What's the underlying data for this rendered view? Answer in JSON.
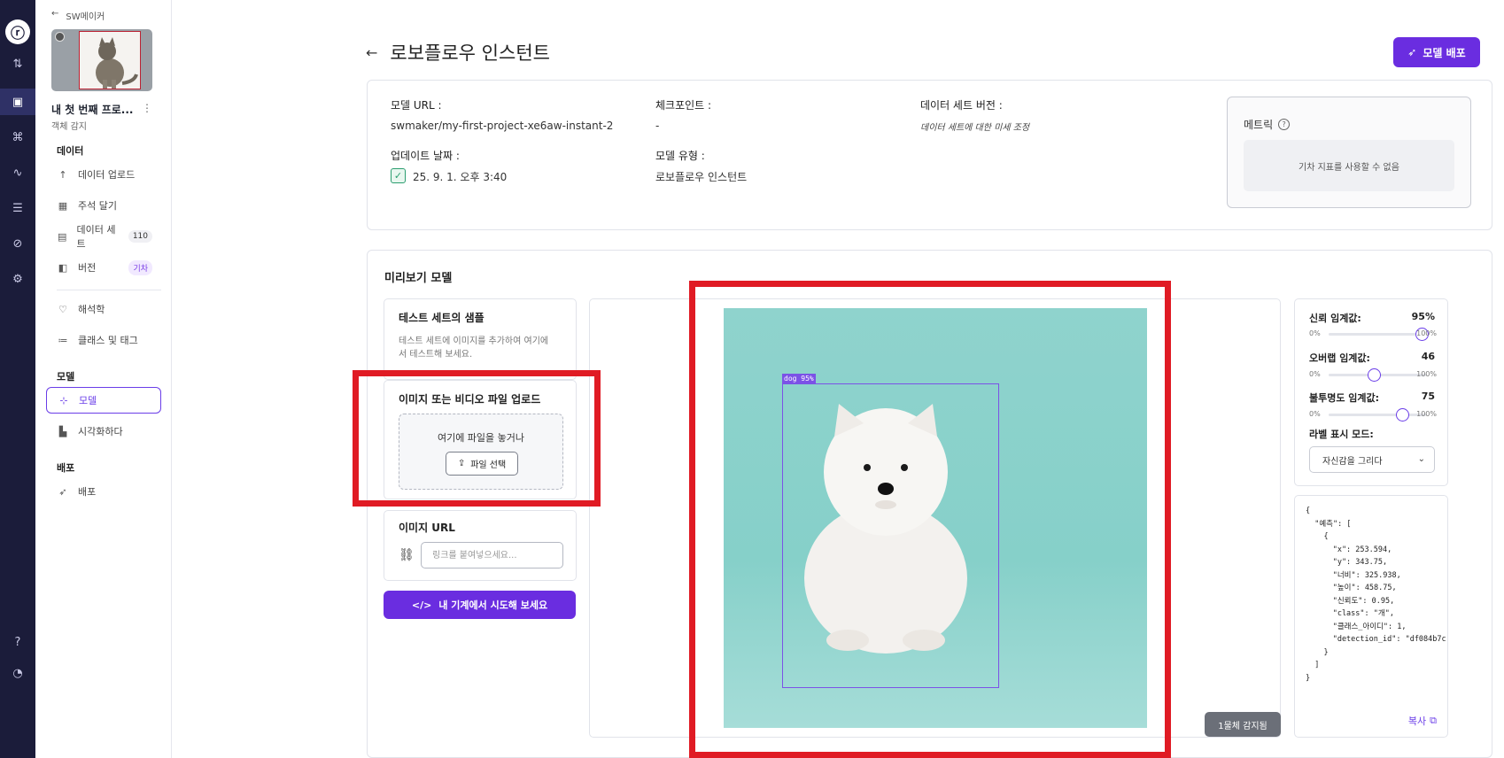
{
  "rail": {
    "icons": [
      "logo-icon",
      "sort-icon",
      "project-icon",
      "hierarchy-icon",
      "analytics-icon",
      "database-icon",
      "compass-icon",
      "settings-icon",
      "help-icon",
      "notification-icon"
    ]
  },
  "sidebar": {
    "back_label": "SW메이커",
    "project_name": "내 첫 번째 프로...",
    "project_type": "객체 감지",
    "sections": {
      "data": "데이터",
      "model": "모델",
      "deploy": "배포"
    },
    "items": {
      "upload": "데이터 업로드",
      "annotate": "주석 달기",
      "dataset": "데이터 세트",
      "dataset_count": "110",
      "version": "버전",
      "version_badge": "기차",
      "analytics": "해석학",
      "classes": "클래스 및 태그",
      "models": "모델",
      "visualize": "시각화하다",
      "deployments": "배포"
    }
  },
  "header": {
    "title": "로보플로우 인스턴트",
    "deploy_button": "모델 배포"
  },
  "info": {
    "model_url_label": "모델 URL :",
    "model_url_value": "swmaker/my-first-project-xe6aw-instant-2",
    "checkpoint_label": "체크포인트 :",
    "checkpoint_value": "-",
    "dataset_version_label": "데이터 세트 버전 :",
    "dataset_version_value": "데이터 세트에 대한 미세 조정",
    "updated_label": "업데이트 날짜 :",
    "updated_value": "25. 9. 1. 오후 3:40",
    "model_type_label": "모델 유형 :",
    "model_type_value": "로보플로우 인스턴트",
    "metrics_title": "메트릭",
    "metrics_empty": "기차 지표를 사용할 수 없음"
  },
  "preview": {
    "title": "미리보기 모델",
    "samples_title": "테스트 세트의 샘플",
    "samples_desc": "테스트 세트에 이미지를 추가하여 여기에서 테스트해 보세요.",
    "upload_title": "이미지 또는 비디오 파일 업로드",
    "drop_text": "여기에 파일을 놓거나",
    "file_button": "파일 선택",
    "url_title": "이미지 URL",
    "url_placeholder": "링크를 붙여넣으세요...",
    "try_button": "내 기계에서 시도해 보세요",
    "bbox_label": "dog 95%",
    "detected_badge": "1물체 감지됨"
  },
  "controls": {
    "confidence_label": "신뢰 임계값:",
    "confidence_value": "95%",
    "confidence": 0.95,
    "overlap_label": "오버랩 임계값:",
    "overlap_value": "46",
    "overlap": 0.46,
    "opacity_label": "불투명도 임계값:",
    "opacity_value": "75",
    "opacity": 0.75,
    "min_label": "0%",
    "max_label": "100%",
    "label_mode_label": "라벨 표시 모드:",
    "label_mode_value": "자신감을 그리다"
  },
  "json_output": "{\n  \"예측\": [\n    {\n      \"x\": 253.594,\n      \"y\": 343.75,\n      \"너비\": 325.938,\n      \"높이\": 458.75,\n      \"신뢰도\": 0.95,\n      \"class\": \"개\",\n      \"클래스_아이디\": 1,\n      \"detection_id\": \"df084b7c-3\n    }\n  ]\n}",
  "copy_button": "복사",
  "colors": {
    "accent": "#6a2de0",
    "highlight": "#e01b24",
    "rail": "#1b1c3a"
  }
}
